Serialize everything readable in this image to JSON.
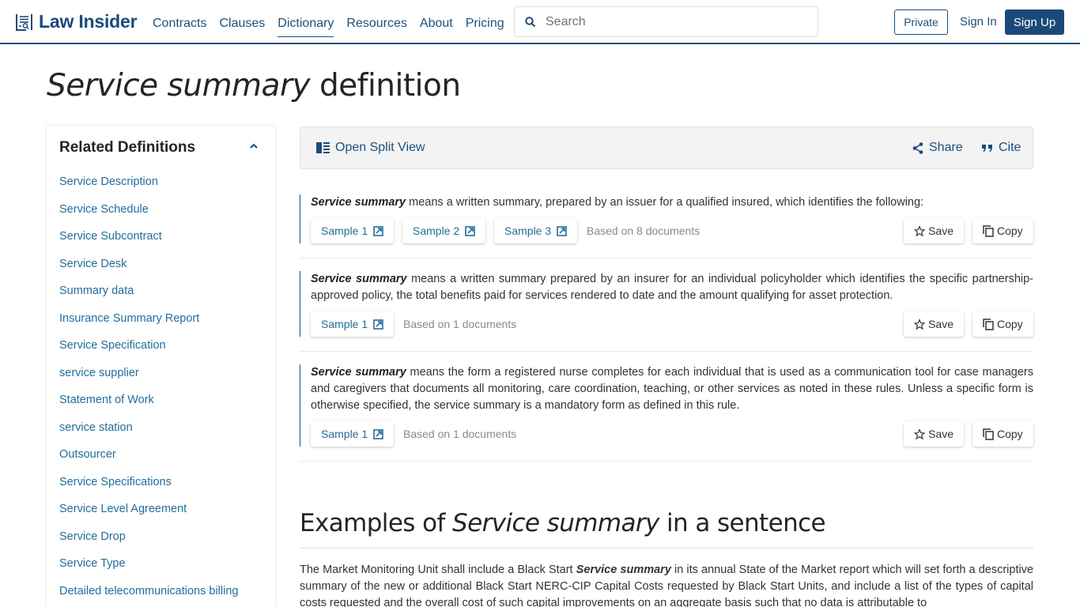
{
  "header": {
    "logo_text": "Law Insider",
    "nav": [
      {
        "label": "Contracts",
        "active": false
      },
      {
        "label": "Clauses",
        "active": false
      },
      {
        "label": "Dictionary",
        "active": true
      },
      {
        "label": "Resources",
        "active": false
      },
      {
        "label": "About",
        "active": false
      },
      {
        "label": "Pricing",
        "active": false
      }
    ],
    "search_placeholder": "Search",
    "search_value": "",
    "private_label": "Private",
    "signin_label": "Sign In",
    "signup_label": "Sign Up"
  },
  "page": {
    "title_term": "Service summary",
    "title_suffix": " definition"
  },
  "sidebar": {
    "heading": "Related Definitions",
    "items": [
      "Service Description",
      "Service Schedule",
      "Service Subcontract",
      "Service Desk",
      "Summary data",
      "Insurance Summary Report",
      "Service Specification",
      "service supplier",
      "Statement of Work",
      "service station",
      "Outsourcer",
      "Service Specifications",
      "Service Level Agreement",
      "Service Drop",
      "Service Type",
      "Detailed telecommunications billing"
    ]
  },
  "toolbar": {
    "split_view_label": "Open Split View",
    "share_label": "Share",
    "cite_label": "Cite"
  },
  "definitions": [
    {
      "term": "Service summary",
      "text": " means a written summary, prepared by an issuer for a qualified insured, which identifies the following:",
      "samples": [
        "Sample 1",
        "Sample 2",
        "Sample 3"
      ],
      "based_on": "Based on 8 documents"
    },
    {
      "term": "Service summary",
      "text": " means a written summary prepared by an insurer for an individual policyholder which identifies the specific partnership-approved policy, the total benefits paid for services rendered to date and the amount qualifying for asset protection.",
      "samples": [
        "Sample 1"
      ],
      "based_on": "Based on 1 documents"
    },
    {
      "term": "Service summary",
      "text": " means the form a registered nurse completes for each individual that is used as a communication tool for case managers and caregivers that documents all monitoring, care coordination, teaching, or other services as noted in these rules. Unless a specific form is otherwise specified, the service summary is a mandatory form as defined in this rule.",
      "samples": [
        "Sample 1"
      ],
      "based_on": "Based on 1 documents"
    }
  ],
  "actions": {
    "save_label": "Save",
    "copy_label": "Copy"
  },
  "examples": {
    "title_prefix": "Examples of ",
    "title_term": "Service summary",
    "title_suffix": " in a sentence",
    "items": [
      {
        "before": "The Market Monitoring Unit shall include a Black Start ",
        "term": "Service summary",
        "after": " in its annual State of the Market report which will set forth a descriptive summary of the new or additional Black Start NERC-CIP Capital Costs requested by Black Start Units, and include a list of the types of capital costs requested and the overall cost of such capital improvements on an aggregate basis such that no data is attributable to"
      }
    ]
  },
  "colors": {
    "brand": "#1b4a7a",
    "link": "#236d9b",
    "muted": "#8a8a8a"
  }
}
